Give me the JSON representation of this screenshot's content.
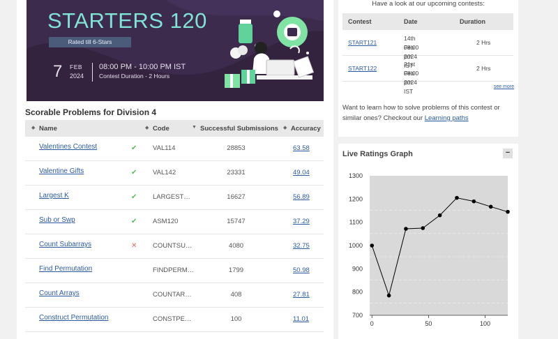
{
  "banner": {
    "title": "STARTERS 120",
    "rated_badge": "Rated till 6-Stars",
    "day": "7",
    "month": "FEB",
    "year": "2024",
    "time_range": "08:00 PM - 10:00 PM IST",
    "duration": "Contest Duration - 2  Hours"
  },
  "problems": {
    "section_title": "Scorable Problems for Division 4",
    "headers": {
      "name": "Name",
      "code": "Code",
      "submissions": "Successful Submissions",
      "accuracy": "Accuracy"
    },
    "rows": [
      {
        "name": "Valentines Contest",
        "status": "solved",
        "mark": "✔",
        "code": "VAL114",
        "submissions": "28853",
        "accuracy": "63.58"
      },
      {
        "name": "Valentine Gifts",
        "status": "solved",
        "mark": "✔",
        "code": "VAL142",
        "submissions": "23331",
        "accuracy": "49.04"
      },
      {
        "name": "Largest K",
        "status": "solved",
        "mark": "✔",
        "code": "LARGEST…",
        "submissions": "16627",
        "accuracy": "56.89"
      },
      {
        "name": "Sub or Swp",
        "status": "solved",
        "mark": "✔",
        "code": "ASM120",
        "submissions": "15747",
        "accuracy": "37.29"
      },
      {
        "name": "Count Subarrays",
        "status": "wrong",
        "mark": "✕",
        "code": "COUNTSU…",
        "submissions": "4080",
        "accuracy": "32.75"
      },
      {
        "name": "Find Permutation",
        "status": "none",
        "mark": "",
        "code": "FINDPERM…",
        "submissions": "1799",
        "accuracy": "50.98"
      },
      {
        "name": "Count Arrays",
        "status": "none",
        "mark": "",
        "code": "COUNTAR…",
        "submissions": "408",
        "accuracy": "27.81"
      },
      {
        "name": "Construct Permutation",
        "status": "none",
        "mark": "",
        "code": "CONSTPE…",
        "submissions": "100",
        "accuracy": "11.01"
      }
    ]
  },
  "upcoming": {
    "heading": "Have a look at our upcoming contests:",
    "headers": {
      "contest": "Contest",
      "date": "Date",
      "duration": "Duration"
    },
    "rows": [
      {
        "code": "START121",
        "date": "14th Feb 2024",
        "time": "08:00 pm IST",
        "duration": "2 Hrs"
      },
      {
        "code": "START122",
        "date": "21st Feb 2024",
        "time": "08:00 pm IST",
        "duration": "2 Hrs"
      }
    ],
    "see_more": "see more",
    "learn_text": "Want to learn how to solve problems of this contest or similar ones? Checkout our ",
    "learn_link": "Learning paths"
  },
  "ratings_graph": {
    "title": "Live Ratings Graph",
    "collapse_label": "−"
  },
  "chart_data": {
    "type": "line",
    "x": [
      0,
      15,
      30,
      45,
      60,
      75,
      90,
      105,
      120
    ],
    "y": [
      1000,
      785,
      1072,
      1075,
      1130,
      1205,
      1190,
      1167,
      1145
    ],
    "xlim": [
      -2,
      120
    ],
    "ylim": [
      700,
      1300
    ],
    "x_ticks": [
      0,
      50,
      100
    ],
    "y_ticks": [
      700,
      800,
      900,
      1000,
      1100,
      1200,
      1300
    ],
    "grid": true,
    "colors": {
      "plot_bg": "#d9d9d9",
      "line": "#000000",
      "point": "#000000"
    }
  }
}
